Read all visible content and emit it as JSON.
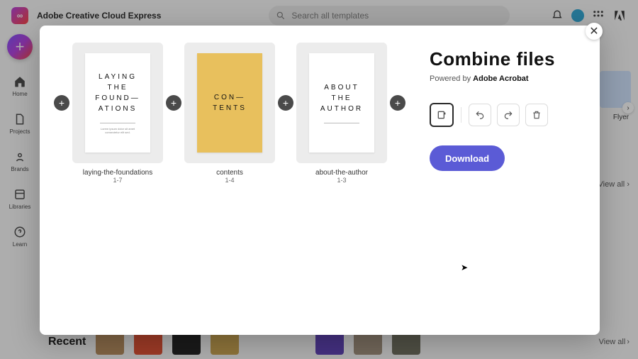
{
  "app": {
    "title": "Adobe Creative Cloud Express"
  },
  "search": {
    "placeholder": "Search all templates"
  },
  "sidebar": {
    "items": [
      {
        "label": "Home"
      },
      {
        "label": "Projects"
      },
      {
        "label": "Brands"
      },
      {
        "label": "Libraries"
      },
      {
        "label": "Learn"
      }
    ]
  },
  "bg": {
    "flyer_label": "Flyer",
    "viewall": "View all",
    "sidechevron": "›"
  },
  "recent": {
    "title": "Recent",
    "viewall": "View all"
  },
  "modal": {
    "title": "Combine files",
    "powered_prefix": "Powered by ",
    "powered_brand": "Adobe Acrobat",
    "download": "Download",
    "close": "✕",
    "files": [
      {
        "name": "laying-the-foundations",
        "range": "1-7",
        "cover_lines": "LAYING\nTHE\nFOUND—\nATIONS",
        "variant": "white"
      },
      {
        "name": "contents",
        "range": "1-4",
        "cover_lines": "CON—\nTENTS",
        "variant": "yellow"
      },
      {
        "name": "about-the-author",
        "range": "1-3",
        "cover_lines": "ABOUT\nTHE\nAUTHOR",
        "variant": "white"
      }
    ]
  }
}
